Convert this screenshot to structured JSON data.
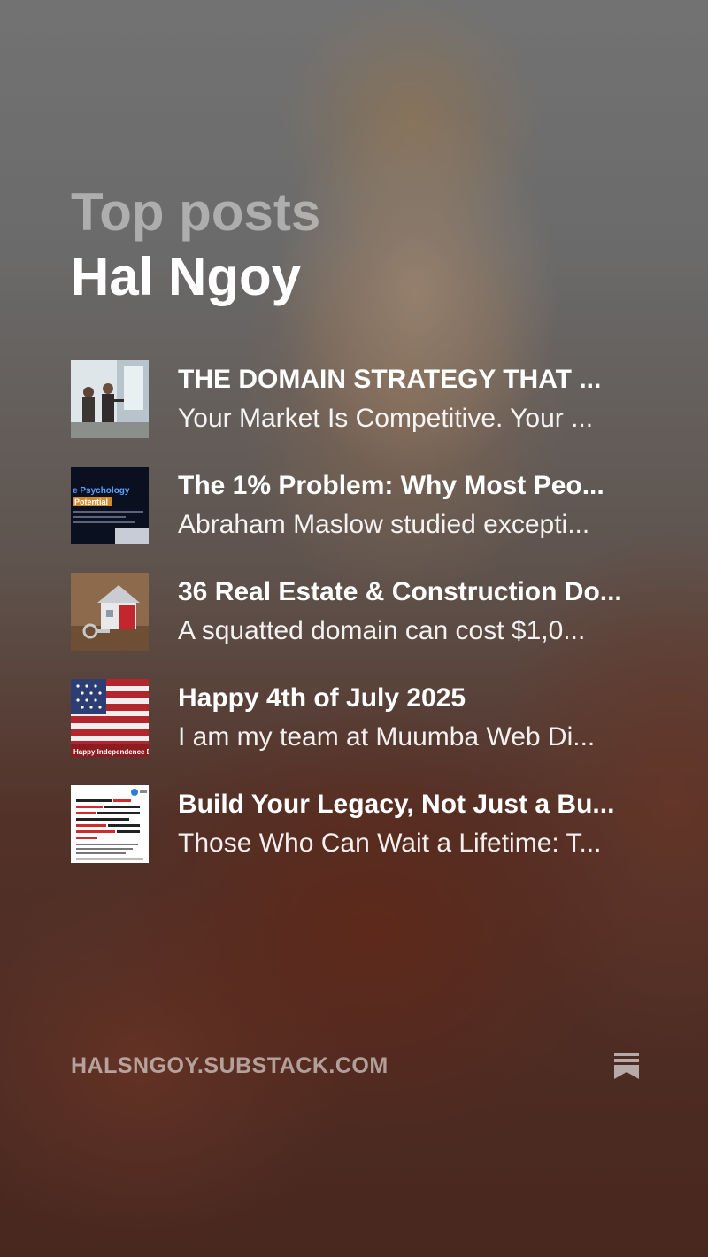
{
  "header": {
    "kicker": "Top posts",
    "author": "Hal Ngoy"
  },
  "posts": [
    {
      "title": "THE DOMAIN STRATEGY THAT ...",
      "subtitle": "Your Market Is Competitive. Your ..."
    },
    {
      "title": "The 1% Problem: Why Most Peo...",
      "subtitle": "Abraham Maslow studied excepti...",
      "thumb_text": [
        "e Psychology",
        "Potential"
      ]
    },
    {
      "title": "36 Real Estate & Construction Do...",
      "subtitle": "A squatted domain can cost $1,0..."
    },
    {
      "title": "Happy 4th of July 2025",
      "subtitle": "I am my team at Muumba Web Di...",
      "thumb_text": [
        "Happy Independence Da"
      ]
    },
    {
      "title": "Build Your Legacy, Not Just a Bu...",
      "subtitle": "Those Who Can Wait a Lifetime: T..."
    }
  ],
  "footer": {
    "url": "HALSNGOY.SUBSTACK.COM",
    "icon": "substack-bookmark-icon"
  }
}
